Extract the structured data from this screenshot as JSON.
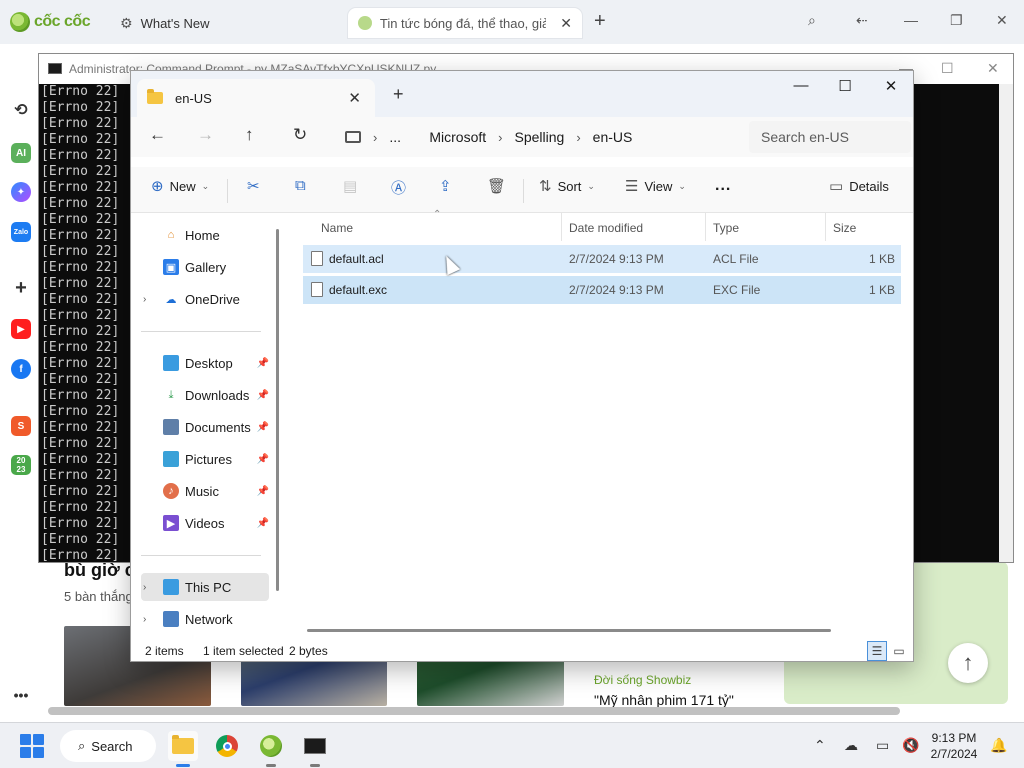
{
  "browser": {
    "logo": "cốc cốc",
    "tabs": [
      {
        "label": "What's New",
        "active": false
      },
      {
        "label": "Tin tức bóng đá, thể thao, giả",
        "active": true
      }
    ],
    "sidebar_icons": [
      "history-icon",
      "ai-icon",
      "messenger-icon",
      "zalo-icon",
      "add-icon",
      "youtube-icon",
      "facebook-icon",
      "shopee-icon",
      "calendar-2023-icon",
      "more-icon"
    ],
    "sidebar_labels": {
      "ai": "AI",
      "zalo": "Zalo",
      "shopee": "S",
      "calendar": "20\n23"
    },
    "news": {
      "heading": "bù giờ c",
      "sub": "5 bàn thắng",
      "category": "Đời sống Showbiz",
      "title": "\"Mỹ nhân phim 171 tỷ\""
    }
  },
  "cmd": {
    "title": "Administrator: Command Prompt - py  MZaSAvTfxbYCXpUSKNUZ.py",
    "lines": [
      "[Errno 22]",
      "[Errno 22]",
      "[Errno 22]",
      "[Errno 22]",
      "[Errno 22]",
      "[Errno 22]",
      "[Errno 22]",
      "[Errno 22]",
      "[Errno 22]",
      "[Errno 22]",
      "[Errno 22]",
      "[Errno 22]",
      "[Errno 22]",
      "[Errno 22]",
      "[Errno 22]",
      "[Errno 22]",
      "[Errno 22]",
      "[Errno 22]",
      "[Errno 22]",
      "[Errno 22]",
      "[Errno 22]",
      "[Errno 22]",
      "[Errno 22]",
      "[Errno 22]",
      "[Errno 22]",
      "[Errno 22]",
      "[Errno 22]",
      "[Errno 22]",
      "[Errno 22]",
      "[Errno 22]"
    ]
  },
  "explorer": {
    "tab_title": "en-US",
    "breadcrumbs": [
      "...",
      "Microsoft",
      "Spelling",
      "en-US"
    ],
    "search_placeholder": "Search en-US",
    "toolbar": {
      "new": "New",
      "sort": "Sort",
      "view": "View",
      "more": "...",
      "details": "Details"
    },
    "nav": {
      "home": "Home",
      "gallery": "Gallery",
      "onedrive": "OneDrive",
      "desktop": "Desktop",
      "downloads": "Downloads",
      "documents": "Documents",
      "pictures": "Pictures",
      "music": "Music",
      "videos": "Videos",
      "thispc": "This PC",
      "network": "Network"
    },
    "columns": {
      "name": "Name",
      "date": "Date modified",
      "type": "Type",
      "size": "Size"
    },
    "files": [
      {
        "name": "default.acl",
        "date": "2/7/2024 9:13 PM",
        "type": "ACL File",
        "size": "1 KB",
        "state": "hover"
      },
      {
        "name": "default.exc",
        "date": "2/7/2024 9:13 PM",
        "type": "EXC File",
        "size": "1 KB",
        "state": "selected"
      }
    ],
    "status": {
      "items": "2 items",
      "selected": "1 item selected",
      "bytes": "2 bytes"
    }
  },
  "taskbar": {
    "search": "Search",
    "time": "9:13 PM",
    "date": "2/7/2024"
  },
  "colors": {
    "accent": "#2b7de9",
    "selection": "#cce4f7",
    "console_bg": "#0c0c0c",
    "coccoc_green": "#6aa52a"
  }
}
